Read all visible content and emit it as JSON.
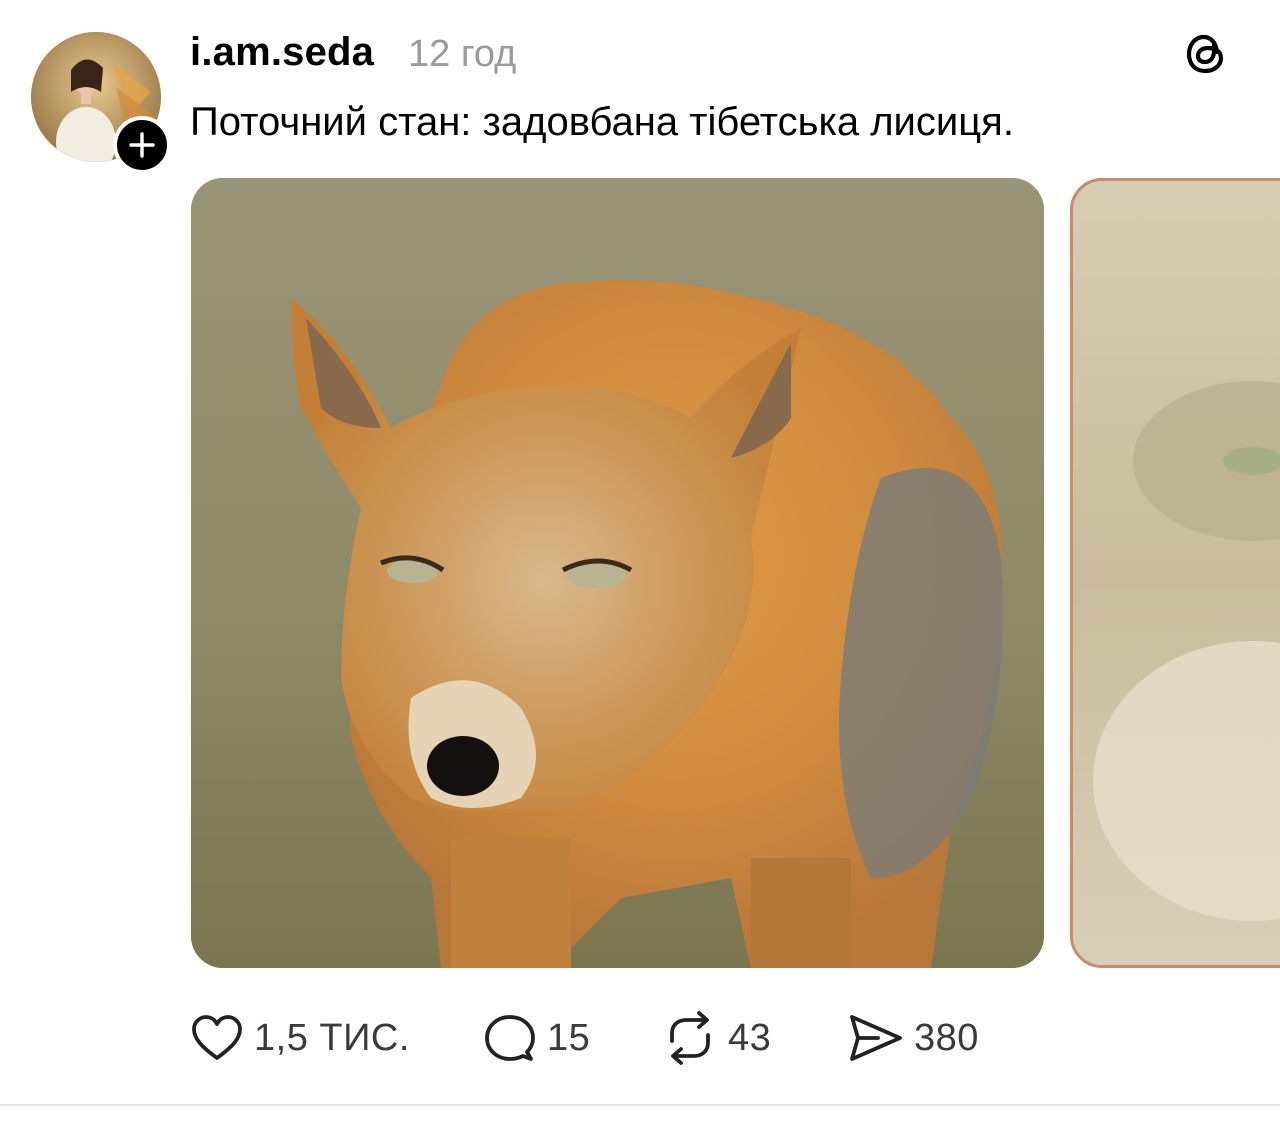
{
  "post": {
    "author": "i.am.seda",
    "time": "12 год",
    "text": "Поточний стан: задовбана тібетська лисиця.",
    "follow_icon": "plus-icon",
    "app_icon": "threads-logo-icon"
  },
  "media": [
    {
      "icon": "image",
      "subject": "tibetan-fox-photo"
    },
    {
      "icon": "image",
      "subject": "tibetan-fox-closeup-photo"
    }
  ],
  "actions": {
    "like": {
      "icon": "heart-icon",
      "count": "1,5 ТИС."
    },
    "reply": {
      "icon": "comment-icon",
      "count": "15"
    },
    "repost": {
      "icon": "repost-icon",
      "count": "43"
    },
    "share": {
      "icon": "send-icon",
      "count": "380"
    }
  },
  "colors": {
    "text": "#000000",
    "muted": "#9a9a9a",
    "counts": "#3a3a3a"
  }
}
